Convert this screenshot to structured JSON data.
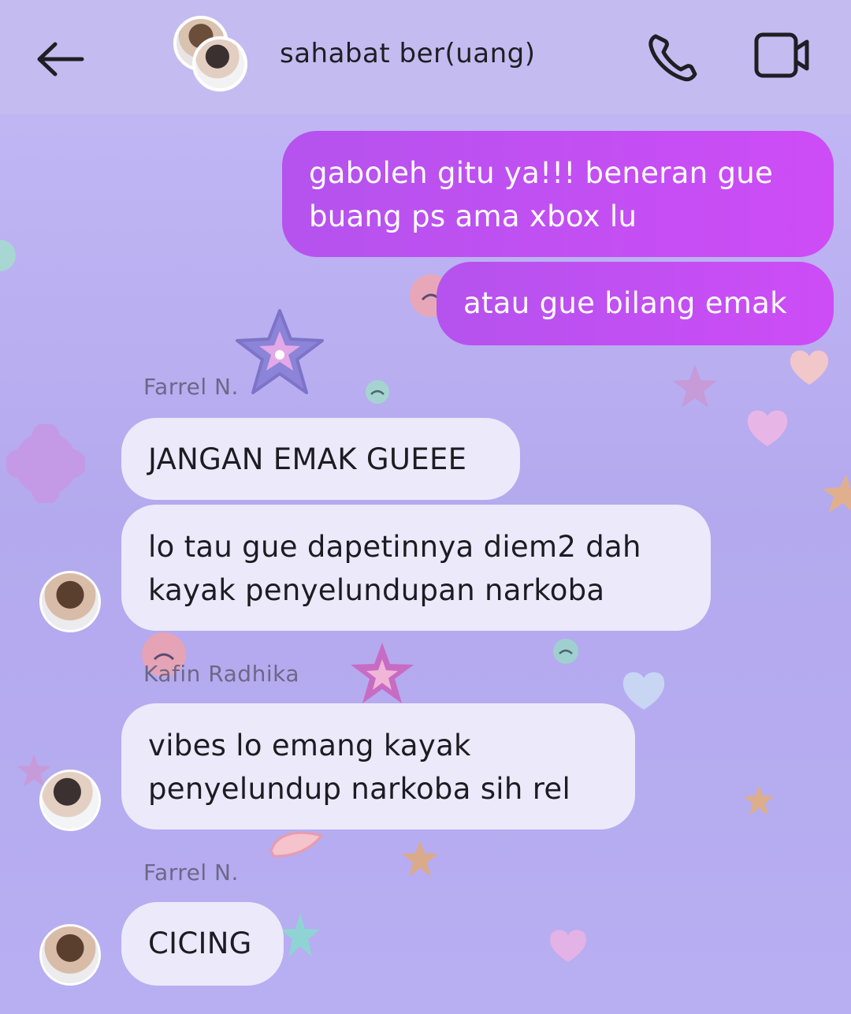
{
  "header": {
    "group_name": "sahabat ber(uang)",
    "icons": {
      "back": "back-arrow-icon",
      "call": "phone-icon",
      "video": "video-camera-icon"
    }
  },
  "colors": {
    "header_bg": "#c4bcf0",
    "chat_bg": "#b8aef2",
    "sent_bubble": "#c04ff2",
    "received_bubble": "#ece9fb"
  },
  "messages": [
    {
      "type": "sent",
      "text_lines": [
        "gaboleh gitu ya!!! beneran gue",
        "buang ps ama xbox lu"
      ]
    },
    {
      "type": "sent",
      "text_lines": [
        "atau gue bilang emak"
      ]
    },
    {
      "type": "sender",
      "name": "Farrel N."
    },
    {
      "type": "received",
      "text_lines": [
        "JANGAN EMAK GUEEE"
      ]
    },
    {
      "type": "received",
      "text_lines": [
        "lo tau gue dapetinnya diem2 dah",
        "kayak penyelundupan narkoba"
      ]
    },
    {
      "type": "sender",
      "name": "Kafin Radhika"
    },
    {
      "type": "received",
      "text_lines": [
        "vibes lo emang kayak",
        "penyelundup narkoba sih rel"
      ]
    },
    {
      "type": "sender",
      "name": "Farrel N."
    },
    {
      "type": "received",
      "text_lines": [
        "CICING"
      ]
    }
  ]
}
